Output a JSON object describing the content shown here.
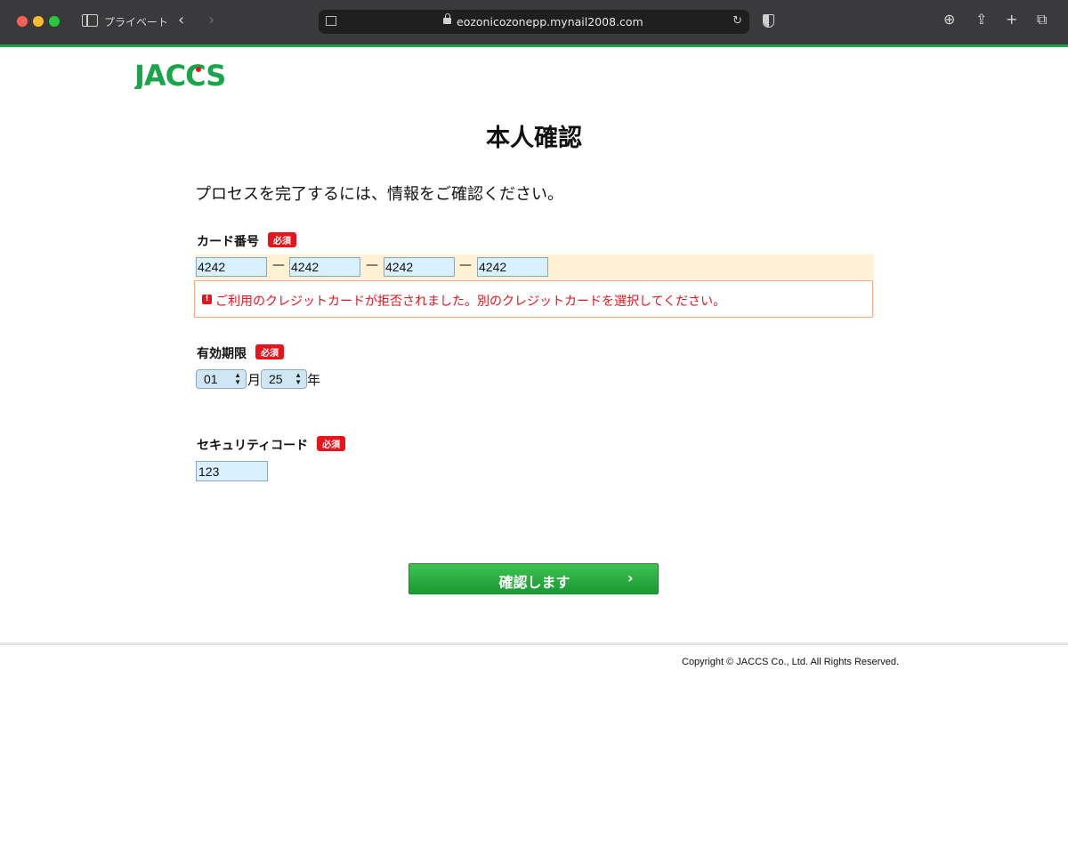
{
  "browser": {
    "mode_label": "プライベート",
    "url": "eozonicozonepp.mynail2008.com",
    "icons": [
      "sidebar-icon",
      "chevron-left-icon",
      "chevron-right-icon",
      "page-icon",
      "lock-icon",
      "reload-icon",
      "shield-icon",
      "download-icon",
      "share-icon",
      "plus-icon",
      "tabs-icon"
    ]
  },
  "brand": {
    "logo_text": "JACCS",
    "logo_color": "#1aa54a"
  },
  "page": {
    "title": "本人確認",
    "intro": "プロセスを完了するには、情報をご確認ください。"
  },
  "form": {
    "required_label": "必須",
    "card": {
      "label": "カード番号",
      "segments": [
        "4242",
        "4242",
        "4242",
        "4242"
      ],
      "separator": "—",
      "error": "ご利用のクレジットカードが拒否されました。別のクレジットカードを選択してください。"
    },
    "expiry": {
      "label": "有効期限",
      "month": "01",
      "month_unit": "月",
      "year": "25",
      "year_unit": "年"
    },
    "security": {
      "label": "セキュリティコード",
      "value": "123"
    },
    "submit_label": "確認します"
  },
  "footer": {
    "copyright": "Copyright © JACCS Co., Ltd. All Rights Reserved."
  },
  "colors": {
    "accent": "#1aa54a",
    "error": "#e8141b",
    "input_bg": "#d8f0ff",
    "row_highlight": "#fff1d3"
  }
}
